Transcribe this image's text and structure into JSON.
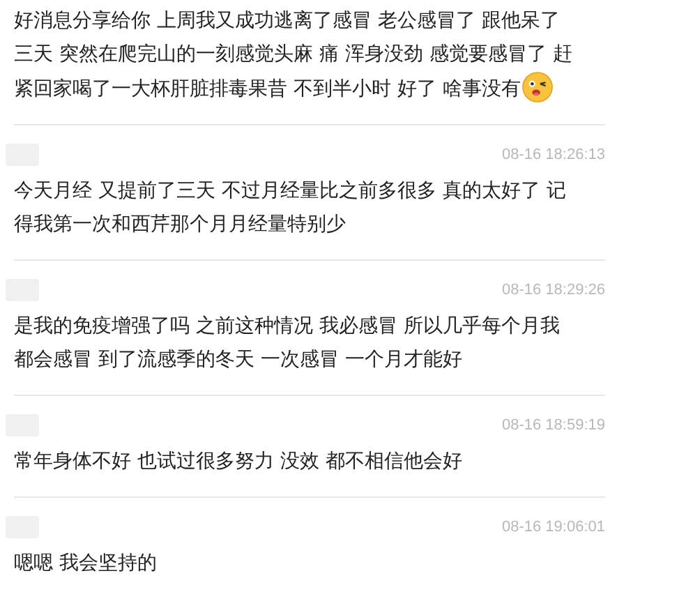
{
  "comments": [
    {
      "has_header": false,
      "lines": [
        "好消息分享给你 上周我又成功逃离了感冒 老公感冒了 跟他呆了",
        "三天 突然在爬完山的一刻感觉头麻 痛 浑身没劲 感觉要感冒了 赶",
        "紧回家喝了一大杯肝脏排毒果昔 不到半小时 好了 啥事没有"
      ],
      "emoji": true
    },
    {
      "has_header": true,
      "time": "08-16 18:26:13",
      "lines": [
        "今天月经 又提前了三天 不过月经量比之前多很多 真的太好了 记",
        "得我第一次和西芹那个月月经量特别少"
      ],
      "emoji": false
    },
    {
      "has_header": true,
      "time": "08-16 18:29:26",
      "lines": [
        "是我的免疫增强了吗 之前这种情况 我必感冒 所以几乎每个月我",
        "都会感冒 到了流感季的冬天 一次感冒 一个月才能好"
      ],
      "emoji": false
    },
    {
      "has_header": true,
      "time": "08-16 18:59:19",
      "lines": [
        "常年身体不好 也试过很多努力 没效 都不相信他会好"
      ],
      "emoji": false
    },
    {
      "has_header": true,
      "time": "08-16 19:06:01",
      "lines": [
        "嗯嗯 我会坚持的"
      ],
      "emoji": false
    }
  ]
}
